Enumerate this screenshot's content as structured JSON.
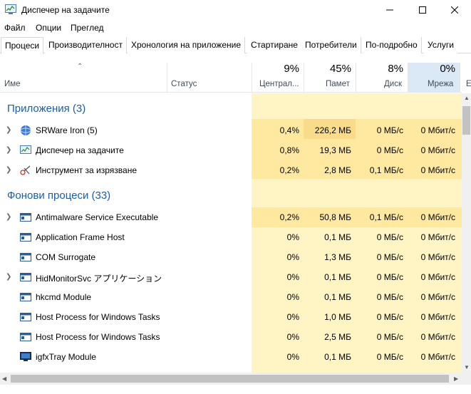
{
  "window": {
    "title": "Диспечер на задачите"
  },
  "menu": [
    "Файл",
    "Опции",
    "Преглед"
  ],
  "tabs": [
    "Процеси",
    "Производителност",
    "Хронология на приложение",
    "Стартиране",
    "Потребители",
    "По-подробно",
    "Услуги"
  ],
  "columns": {
    "name": "Име",
    "status": "Статус",
    "cpu": {
      "pct": "9%",
      "label": "Централ..."
    },
    "memory": {
      "pct": "45%",
      "label": "Памет"
    },
    "disk": {
      "pct": "8%",
      "label": "Диск"
    },
    "network": {
      "pct": "0%",
      "label": "Мрежа"
    },
    "extra_label": "Е"
  },
  "groups": {
    "apps": "Приложения (3)",
    "background": "Фонови процеси (33)"
  },
  "apps": [
    {
      "name": "SRWare Iron (5)",
      "cpu": "0,4%",
      "mem": "226,2 МБ",
      "disk": "0 МБ/с",
      "net": "0 Мбит/с",
      "icon": "globe-icon"
    },
    {
      "name": "Диспечер на задачите",
      "cpu": "0,8%",
      "mem": "19,3 МБ",
      "disk": "0 МБ/с",
      "net": "0 Мбит/с",
      "icon": "task-manager-icon"
    },
    {
      "name": "Инструмент за изрязване",
      "cpu": "0,2%",
      "mem": "2,8 МБ",
      "disk": "0,1 МБ/с",
      "net": "0 Мбит/с",
      "icon": "scissors-icon"
    }
  ],
  "background": [
    {
      "name": "Antimalware Service Executable",
      "cpu": "0,2%",
      "mem": "50,8 МБ",
      "disk": "0,1 МБ/с",
      "net": "0 Мбит/с"
    },
    {
      "name": "Application Frame Host",
      "cpu": "0%",
      "mem": "0,1 МБ",
      "disk": "0 МБ/с",
      "net": "0 Мбит/с"
    },
    {
      "name": "COM Surrogate",
      "cpu": "0%",
      "mem": "1,3 МБ",
      "disk": "0 МБ/с",
      "net": "0 Мбит/с"
    },
    {
      "name": "HidMonitorSvc アプリケーション",
      "cpu": "0%",
      "mem": "0,1 МБ",
      "disk": "0 МБ/с",
      "net": "0 Мбит/с"
    },
    {
      "name": "hkcmd Module",
      "cpu": "0%",
      "mem": "0,1 МБ",
      "disk": "0 МБ/с",
      "net": "0 Мбит/с"
    },
    {
      "name": "Host Process for Windows Tasks",
      "cpu": "0%",
      "mem": "1,0 МБ",
      "disk": "0 МБ/с",
      "net": "0 Мбит/с"
    },
    {
      "name": "Host Process for Windows Tasks",
      "cpu": "0%",
      "mem": "2,5 МБ",
      "disk": "0 МБ/с",
      "net": "0 Мбит/с"
    },
    {
      "name": "igfxTray Module",
      "cpu": "0%",
      "mem": "0,1 МБ",
      "disk": "0 МБ/с",
      "net": "0 Мбит/с"
    }
  ],
  "colors": {
    "heat_light": "#fff4c4",
    "heat_medium": "#ffe8a0",
    "heat_strong": "#f9dc8a",
    "group_title": "#1a5ea8",
    "network_header": "#dbe9f7"
  }
}
